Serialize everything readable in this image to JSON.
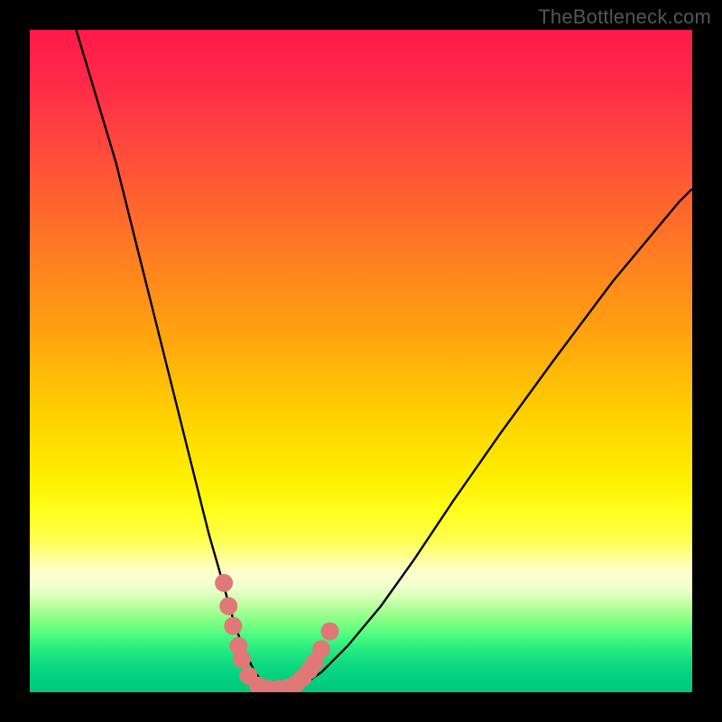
{
  "watermark": "TheBottleneck.com",
  "chart_data": {
    "type": "line",
    "title": "",
    "xlabel": "",
    "ylabel": "",
    "xlim": [
      0,
      100
    ],
    "ylim": [
      0,
      100
    ],
    "series": [
      {
        "name": "bottleneck-curve",
        "x": [
          7,
          10,
          13,
          16,
          19,
          22,
          25,
          27,
          29,
          31,
          32.5,
          34,
          35.5,
          37,
          39,
          41,
          44,
          48,
          53,
          58,
          64,
          71,
          79,
          88,
          98,
          100
        ],
        "values": [
          100,
          90,
          80,
          68,
          56,
          44,
          32,
          24,
          17,
          10,
          6,
          3,
          1,
          0.5,
          0.5,
          1,
          3,
          7,
          13,
          20,
          29,
          39,
          50,
          62,
          74,
          76
        ]
      }
    ],
    "markers": {
      "name": "highlight-dots",
      "color": "#e07878",
      "points": [
        {
          "x": 29.3,
          "y": 16.5
        },
        {
          "x": 30.0,
          "y": 13.0
        },
        {
          "x": 30.7,
          "y": 10.0
        },
        {
          "x": 31.5,
          "y": 7.0
        },
        {
          "x": 32.0,
          "y": 5.0
        },
        {
          "x": 33.0,
          "y": 2.5
        },
        {
          "x": 34.5,
          "y": 1.0
        },
        {
          "x": 36.0,
          "y": 0.5
        },
        {
          "x": 37.5,
          "y": 0.5
        },
        {
          "x": 39.0,
          "y": 0.7
        },
        {
          "x": 40.2,
          "y": 1.3
        },
        {
          "x": 41.2,
          "y": 2.2
        },
        {
          "x": 42.2,
          "y": 3.3
        },
        {
          "x": 43.0,
          "y": 4.5
        },
        {
          "x": 44.0,
          "y": 6.5
        },
        {
          "x": 45.3,
          "y": 9.2
        }
      ]
    },
    "background_gradient": {
      "stops": [
        {
          "pos": 0,
          "color": "#ff1a4a"
        },
        {
          "pos": 50,
          "color": "#ffd000"
        },
        {
          "pos": 80,
          "color": "#ffffc0"
        },
        {
          "pos": 100,
          "color": "#00c878"
        }
      ]
    }
  }
}
